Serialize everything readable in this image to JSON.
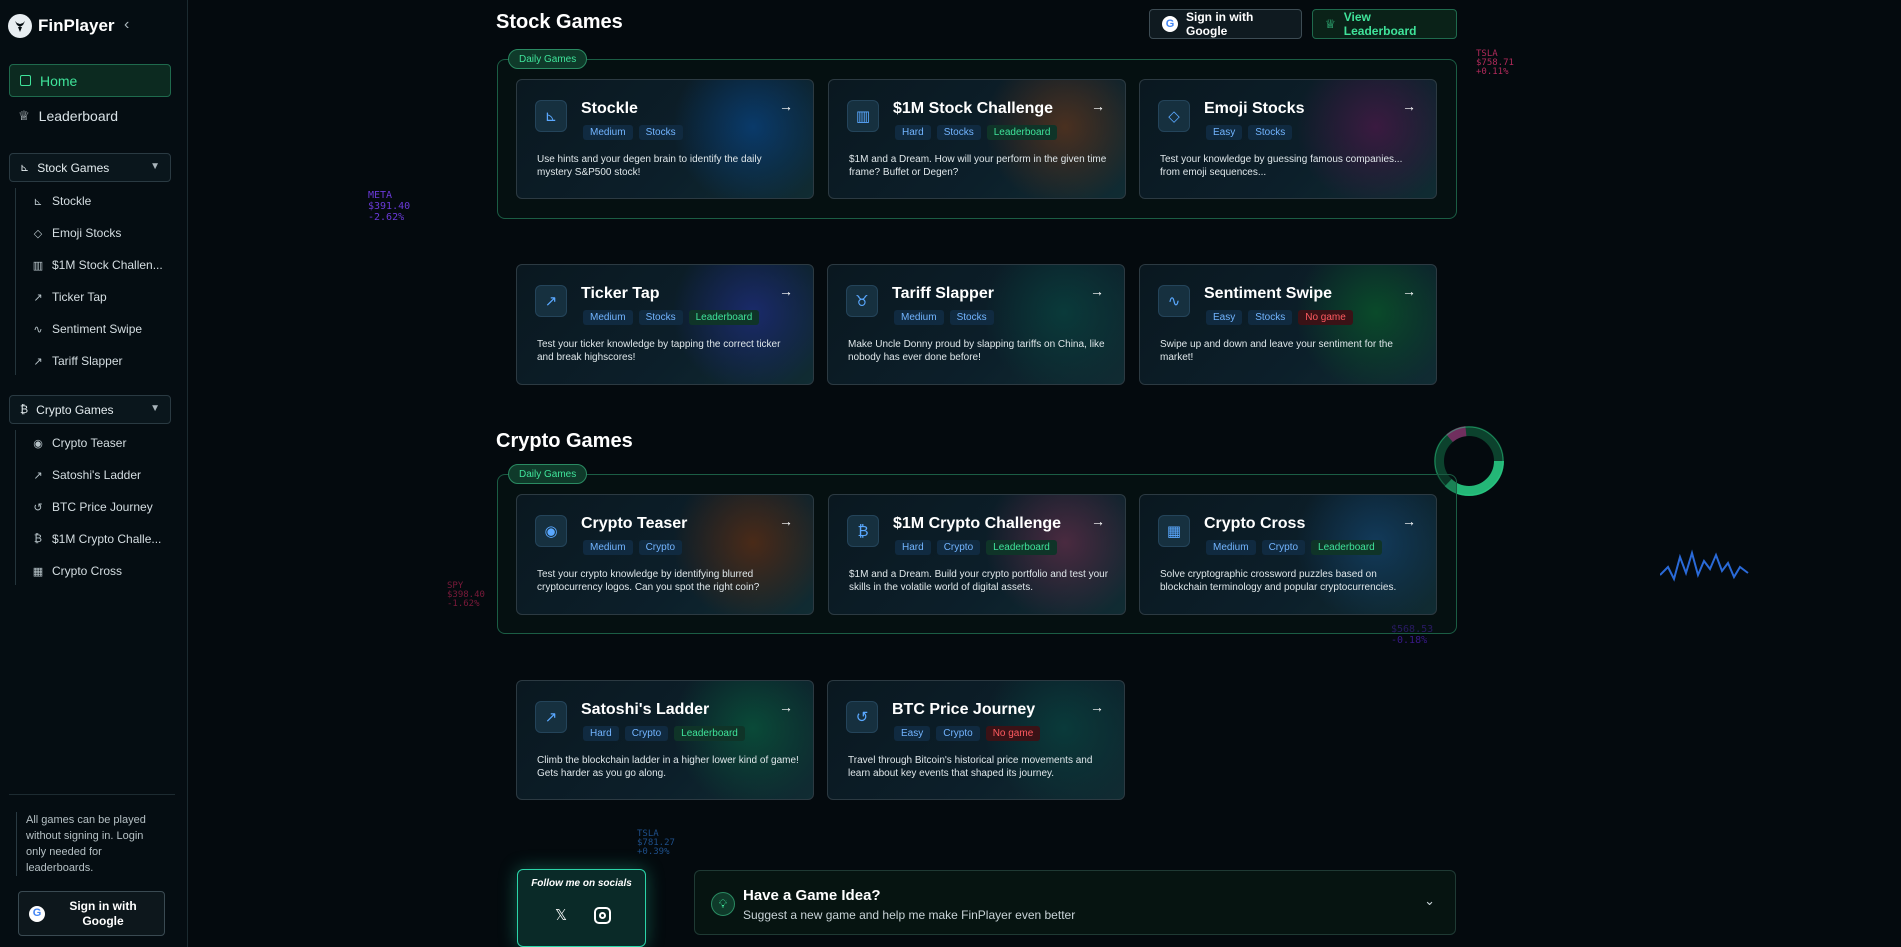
{
  "brand": {
    "name": "FinPlayer",
    "collapse_icon": "chevron-left-icon"
  },
  "sidebar": {
    "home": "Home",
    "leaderboard": "Leaderboard",
    "stock_group": {
      "label": "Stock Games",
      "items": [
        "Stockle",
        "Emoji Stocks",
        "$1M Stock Challen...",
        "Ticker Tap",
        "Sentiment Swipe",
        "Tariff Slapper"
      ]
    },
    "crypto_group": {
      "label": "Crypto Games",
      "items": [
        "Crypto Teaser",
        "Satoshi's Ladder",
        "BTC Price Journey",
        "$1M Crypto Challe...",
        "Crypto Cross"
      ]
    },
    "note": "All games can be played without signing in. Login only needed for leaderboards.",
    "signin": "Sign in with Google"
  },
  "header": {
    "stock_title": "Stock Games",
    "crypto_title": "Crypto Games",
    "signin": "Sign in with Google",
    "view_leaderboard": "View Leaderboard",
    "daily_tag": "Daily Games"
  },
  "stock_cards": [
    {
      "title": "Stockle",
      "tags": [
        "Medium",
        "Stocks"
      ],
      "desc": "Use hints and your degen brain to identify the daily mystery S&P500 stock!"
    },
    {
      "title": "$1M Stock Challenge",
      "tags": [
        "Hard",
        "Stocks",
        "Leaderboard"
      ],
      "desc": "$1M and a Dream. How will your perform in the given time frame? Buffet or Degen?"
    },
    {
      "title": "Emoji Stocks",
      "tags": [
        "Easy",
        "Stocks"
      ],
      "desc": "Test your knowledge by guessing famous companies... from emoji sequences..."
    },
    {
      "title": "Ticker Tap",
      "tags": [
        "Medium",
        "Stocks",
        "Leaderboard"
      ],
      "desc": "Test your ticker knowledge by tapping the correct ticker and break highscores!"
    },
    {
      "title": "Tariff Slapper",
      "tags": [
        "Medium",
        "Stocks"
      ],
      "desc": "Make Uncle Donny proud by slapping tariffs on China, like nobody has ever done before!"
    },
    {
      "title": "Sentiment Swipe",
      "tags": [
        "Easy",
        "Stocks",
        "No game"
      ],
      "desc": "Swipe up and down and leave your sentiment for the market!"
    }
  ],
  "crypto_cards": [
    {
      "title": "Crypto Teaser",
      "tags": [
        "Medium",
        "Crypto"
      ],
      "desc": "Test your crypto knowledge by identifying blurred cryptocurrency logos. Can you spot the right coin?"
    },
    {
      "title": "$1M Crypto Challenge",
      "tags": [
        "Hard",
        "Crypto",
        "Leaderboard"
      ],
      "desc": "$1M and a Dream. Build your crypto portfolio and test your skills in the volatile world of digital assets."
    },
    {
      "title": "Crypto Cross",
      "tags": [
        "Medium",
        "Crypto",
        "Leaderboard"
      ],
      "desc": "Solve cryptographic crossword puzzles based on blockchain terminology and popular cryptocurrencies."
    },
    {
      "title": "Satoshi's Ladder",
      "tags": [
        "Hard",
        "Crypto",
        "Leaderboard"
      ],
      "desc": "Climb the blockchain ladder in a higher lower kind of game! Gets harder as you go along."
    },
    {
      "title": "BTC Price Journey",
      "tags": [
        "Easy",
        "Crypto",
        "No game"
      ],
      "desc": "Travel through Bitcoin's historical price movements and learn about key events that shaped its journey."
    }
  ],
  "socials": {
    "label": "Follow me on socials"
  },
  "idea": {
    "title": "Have a Game Idea?",
    "subtitle": "Suggest a new game and help me make FinPlayer even better"
  },
  "tickers": {
    "meta": [
      "META",
      "$391.40",
      "-2.62%"
    ],
    "tsla_top": [
      "TSLA",
      "$758.71",
      "+0.11%"
    ],
    "tsla_bottom": [
      "TSLA",
      "$781.27",
      "+0.39%"
    ],
    "spy": [
      "SPY",
      "$398.40",
      "-1.62%"
    ],
    "price_right": [
      "$568.53",
      "-0.18%"
    ]
  },
  "colors": {
    "accent": "#3fe39a",
    "blue": "#5aa8ff",
    "red": "#ff5a60"
  }
}
